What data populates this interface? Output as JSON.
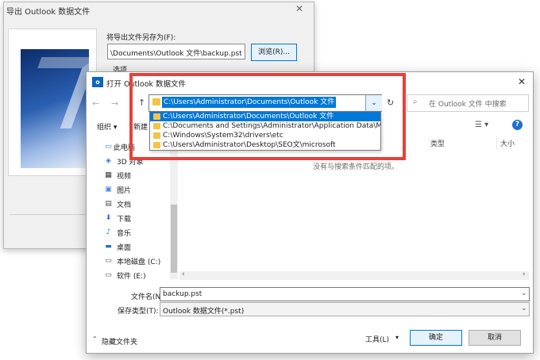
{
  "export_dialog": {
    "title": "导出 Outlook 数据文件",
    "save_as_label": "将导出文件另存为(F):",
    "save_path": "\\Documents\\Outlook 文件\\backup.pst",
    "browse_label": "浏览(R)...",
    "options_label": "选项"
  },
  "open_dialog": {
    "title": "打开 Outlook 数据文件",
    "app_icon_letter": "o",
    "address": "C:\\Users\\Administrator\\Documents\\Outlook 文件",
    "search_placeholder": "在 Outlook 文件 中搜索",
    "organize_label": "组织 ▾",
    "new_folder_label": "新建",
    "address_history": [
      "C:\\Users\\Administrator\\Documents\\Outlook 文件",
      "C:\\Documents and Settings\\Administrator\\Application Data\\Mi",
      "C:\\Windows\\System32\\drivers\\etc",
      "C:\\Users\\Administrator\\Desktop\\SEO文\\microsoft"
    ],
    "nav_items": [
      {
        "label": "此电脑",
        "icon": "computer-icon"
      },
      {
        "label": "3D 对象",
        "icon": "3d-objects-icon"
      },
      {
        "label": "视频",
        "icon": "video-icon"
      },
      {
        "label": "图片",
        "icon": "picture-icon"
      },
      {
        "label": "文档",
        "icon": "document-icon"
      },
      {
        "label": "下载",
        "icon": "download-icon"
      },
      {
        "label": "音乐",
        "icon": "music-icon"
      },
      {
        "label": "桌面",
        "icon": "desktop-icon"
      },
      {
        "label": "本地磁盘 (C:)",
        "icon": "drive-icon"
      },
      {
        "label": "软件 (E:)",
        "icon": "drive-icon"
      }
    ],
    "columns": {
      "type": "类型",
      "size": "大小"
    },
    "empty_message": "没有与搜索条件匹配的项。",
    "filename_label": "文件名(N):",
    "filename_value": "backup.pst",
    "filetype_label": "保存类型(T):",
    "filetype_value": "Outlook 数据文件(*.pst)",
    "hide_folders_label": "隐藏文件夹",
    "tools_label": "工具(L)",
    "ok_label": "确定",
    "cancel_label": "取消"
  },
  "colors": {
    "accent": "#0078d7",
    "highlight_box": "#e8403a",
    "folder": "#f3c44a"
  }
}
